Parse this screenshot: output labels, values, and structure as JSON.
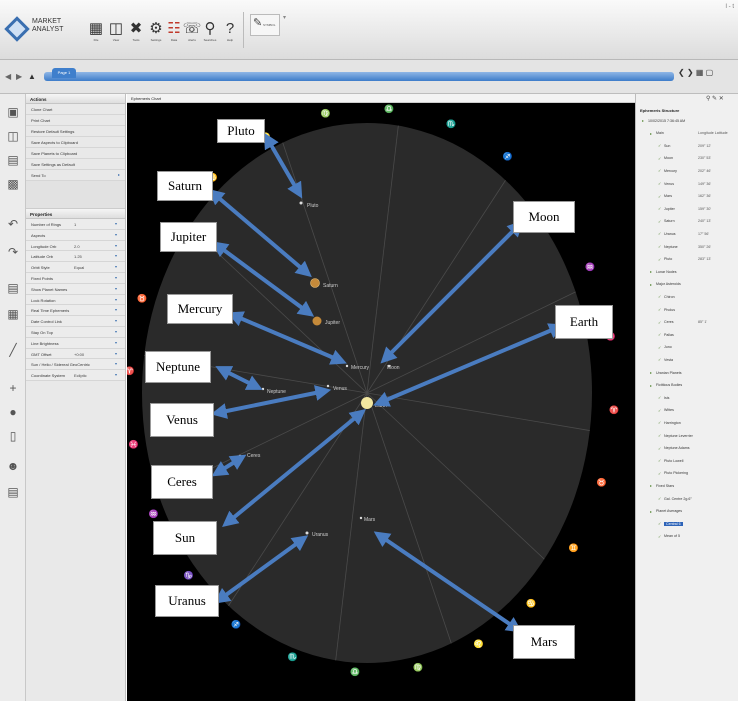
{
  "app": {
    "logo_text": "MARKET ANALYST",
    "window_controls": "I - t"
  },
  "toolbar": {
    "buttons": [
      {
        "label": "File",
        "icon": "folder-icon"
      },
      {
        "label": "View",
        "icon": "pages-icon"
      },
      {
        "label": "Tools",
        "icon": "tools-icon"
      },
      {
        "label": "Settings",
        "icon": "gears-icon"
      },
      {
        "label": "Data",
        "icon": "data-icon"
      },
      {
        "label": "Alerts",
        "icon": "alarm-icon"
      },
      {
        "label": "Searches",
        "icon": "search-icon"
      },
      {
        "label": "Help",
        "icon": "help-icon"
      }
    ],
    "symbol_label": "SYMBOL"
  },
  "tabs": {
    "active": "Page 1"
  },
  "left_panel": {
    "actions_title": "Actions",
    "actions": [
      "Clone Chart",
      "Print Chart",
      "Restore Default Settings",
      "Save Aspects to Clipboard",
      "Save Planets to Clipboard",
      "Save Settings as Default",
      "Send To"
    ],
    "properties_title": "Properties",
    "properties": [
      {
        "name": "Number of Rings",
        "value": "1"
      },
      {
        "name": "Aspects",
        "value": ""
      },
      {
        "name": "Longitude Orb",
        "value": "2.0"
      },
      {
        "name": "Latitude Orb",
        "value": "1.25"
      },
      {
        "name": "Orbit Style",
        "value": "Equal"
      },
      {
        "name": "Fixed Points",
        "value": ""
      },
      {
        "name": "Show Planet Names",
        "value": ""
      },
      {
        "name": "Lock Rotation",
        "value": ""
      },
      {
        "name": "Real Time Ephemeris",
        "value": ""
      },
      {
        "name": "Date Control Link",
        "value": ""
      },
      {
        "name": "Stay On Top",
        "value": ""
      },
      {
        "name": "Line Brightness",
        "value": ""
      },
      {
        "name": "GMT Offset",
        "value": "+0:00"
      },
      {
        "name": "Sun / Helio / Sidereal GeoCentric",
        "value": ""
      },
      {
        "name": "Coordinate System",
        "value": "Ecliptic"
      }
    ]
  },
  "chart_panel": {
    "title": "Ephemeris Chart",
    "labels": {
      "pluto": "Pluto",
      "saturn": "Saturn",
      "jupiter": "Jupiter",
      "mercury": "Mercury",
      "moon": "Moon",
      "neptune": "Neptune",
      "venus": "Venus",
      "earth": "Earth",
      "ceres": "Ceres",
      "sun": "Sun",
      "uranus": "Uranus",
      "mars": "Mars"
    },
    "callouts": {
      "pluto": "Pluto",
      "saturn": "Saturn",
      "jupiter": "Jupiter",
      "mercury": "Mercury",
      "neptune": "Neptune",
      "venus": "Venus",
      "ceres": "Ceres",
      "sun": "Sun",
      "uranus": "Uranus",
      "moon": "Moon",
      "earth": "Earth",
      "mars": "Mars"
    }
  },
  "right_panel": {
    "title": "Ephemeris Structure",
    "tree": [
      {
        "label": "10/02/2015 7:36:45 AM",
        "indent": 0,
        "extra": ""
      },
      {
        "label": "Main",
        "indent": 1,
        "extra": "Longitude  Latitude"
      },
      {
        "label": "Sun",
        "indent": 2,
        "extra": "209° 12'"
      },
      {
        "label": "Moon",
        "indent": 2,
        "extra": "230° 53'"
      },
      {
        "label": "Mercury",
        "indent": 2,
        "extra": "202° 46'"
      },
      {
        "label": "Venus",
        "indent": 2,
        "extra": "149° 36'"
      },
      {
        "label": "Mars",
        "indent": 2,
        "extra": "162° 36'"
      },
      {
        "label": "Jupiter",
        "indent": 2,
        "extra": "159° 30'"
      },
      {
        "label": "Saturn",
        "indent": 2,
        "extra": "240° 13'"
      },
      {
        "label": "Uranus",
        "indent": 2,
        "extra": "17° 56'"
      },
      {
        "label": "Neptune",
        "indent": 2,
        "extra": "350° 26'"
      },
      {
        "label": "Pluto",
        "indent": 2,
        "extra": "283° 13'"
      },
      {
        "label": "Lunar Nodes",
        "indent": 1,
        "extra": ""
      },
      {
        "label": "Major Asteroids",
        "indent": 1,
        "extra": ""
      },
      {
        "label": "Chiron",
        "indent": 2,
        "extra": ""
      },
      {
        "label": "Pholus",
        "indent": 2,
        "extra": ""
      },
      {
        "label": "Ceres",
        "indent": 2,
        "extra": "85° 1'"
      },
      {
        "label": "Pallas",
        "indent": 2,
        "extra": ""
      },
      {
        "label": "Juno",
        "indent": 2,
        "extra": ""
      },
      {
        "label": "Vesta",
        "indent": 2,
        "extra": ""
      },
      {
        "label": "Uranian Planets",
        "indent": 1,
        "extra": ""
      },
      {
        "label": "Fictitious Bodies",
        "indent": 1,
        "extra": ""
      },
      {
        "label": "Isis",
        "indent": 2,
        "extra": ""
      },
      {
        "label": "Wittes",
        "indent": 2,
        "extra": ""
      },
      {
        "label": "Harrington",
        "indent": 2,
        "extra": ""
      },
      {
        "label": "Neptune Leverrier",
        "indent": 2,
        "extra": ""
      },
      {
        "label": "Neptune Adams",
        "indent": 2,
        "extra": ""
      },
      {
        "label": "Pluto Lowell",
        "indent": 2,
        "extra": ""
      },
      {
        "label": "Pluto Pickering",
        "indent": 2,
        "extra": ""
      },
      {
        "label": "Fixed Stars",
        "indent": 1,
        "extra": ""
      },
      {
        "label": "Gal. Centre 2g.6°",
        "indent": 2,
        "extra": ""
      },
      {
        "label": "Planet Averages",
        "indent": 1,
        "extra": ""
      },
      {
        "label": "Central 6",
        "indent": 2,
        "extra": "",
        "selected": true
      },
      {
        "label": "Mean of 5",
        "indent": 2,
        "extra": ""
      }
    ]
  },
  "colors": {
    "arrow": "#4a7cc0",
    "chart_bg": "#000000",
    "disc": "#2a2a2a",
    "sun": "#f2e7a0",
    "tab_blue": "#3d7cc9"
  }
}
